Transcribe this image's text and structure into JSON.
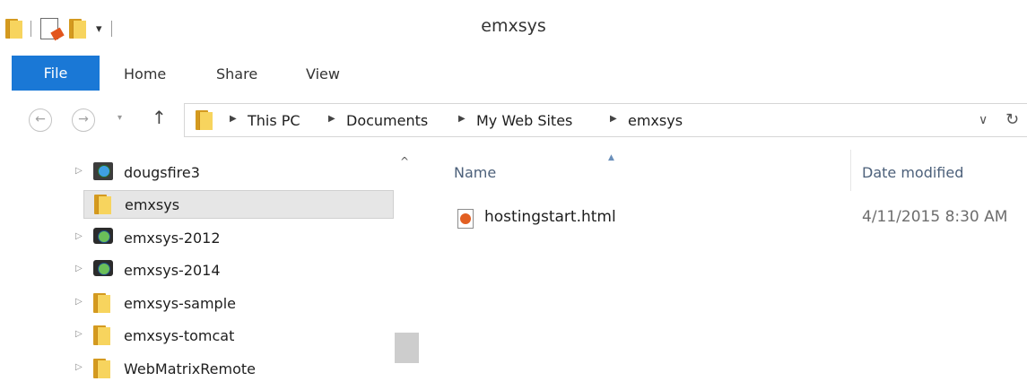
{
  "window": {
    "title": "emxsys"
  },
  "quick_access": {
    "dropdown_glyph": "▾"
  },
  "ribbon": {
    "tabs": [
      "File",
      "Home",
      "Share",
      "View"
    ]
  },
  "nav": {
    "back_glyph": "←",
    "forward_glyph": "→",
    "recent_glyph": "▾",
    "up_glyph": "↑",
    "breadcrumb": [
      "This PC",
      "Documents",
      "My Web Sites",
      "emxsys"
    ],
    "dropdown_glyph": "∨",
    "refresh_glyph": "↻"
  },
  "tree": {
    "items": [
      {
        "label": "dougsfire3",
        "icon": "website-icon",
        "expandable": true,
        "selected": false
      },
      {
        "label": "emxsys",
        "icon": "folder-icon",
        "expandable": false,
        "selected": true
      },
      {
        "label": "emxsys-2012",
        "icon": "camera-icon",
        "expandable": true,
        "selected": false
      },
      {
        "label": "emxsys-2014",
        "icon": "camera-icon",
        "expandable": true,
        "selected": false
      },
      {
        "label": "emxsys-sample",
        "icon": "folder-icon",
        "expandable": true,
        "selected": false
      },
      {
        "label": "emxsys-tomcat",
        "icon": "folder-icon",
        "expandable": true,
        "selected": false
      },
      {
        "label": "WebMatrixRemote",
        "icon": "folder-icon",
        "expandable": true,
        "selected": false
      }
    ]
  },
  "files": {
    "columns": {
      "name": "Name",
      "date": "Date modified"
    },
    "rows": [
      {
        "name": "hostingstart.html",
        "date": "4/11/2015 8:30 AM",
        "icon": "html-file-icon"
      }
    ]
  }
}
